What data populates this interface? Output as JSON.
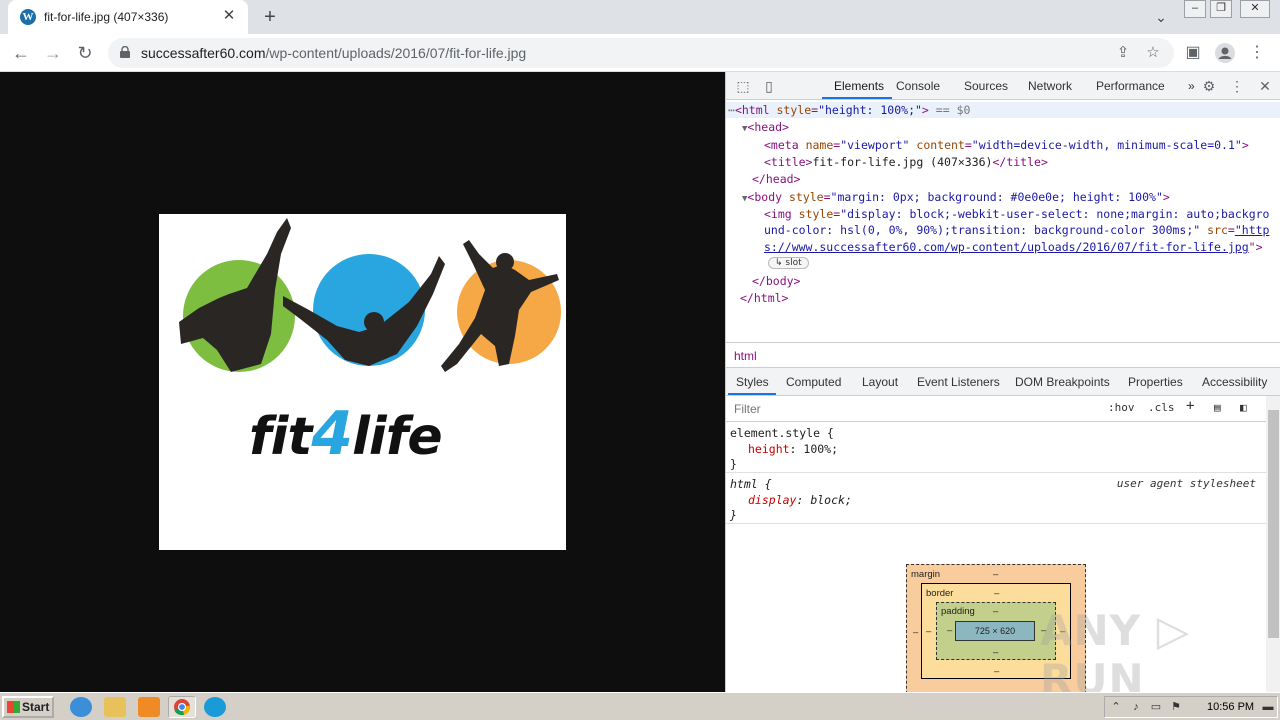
{
  "browser": {
    "tab_title": "fit-for-life.jpg (407×336)",
    "tab_close": "✕",
    "new_tab": "+",
    "url_host": "successafter60.com",
    "url_path": "/wp-content/uploads/2016/07/fit-for-life.jpg"
  },
  "image": {
    "logo_left": "fit",
    "logo_four": "4",
    "logo_right": "life"
  },
  "devtools": {
    "tabs": [
      "Elements",
      "Console",
      "Sources",
      "Network",
      "Performance"
    ],
    "more": "»",
    "dom": {
      "html_open": "<html",
      "html_attr_name": "style",
      "html_attr_val": "\"height: 100%;\"",
      "html_suffix": "== $0",
      "head_open": "<head>",
      "meta_name_attr": "name",
      "meta_name_val": "\"viewport\"",
      "meta_content_attr": "content",
      "meta_content_val": "\"width=device-width, minimum-scale=0.1\"",
      "title_open": "<title>",
      "title_text": "fit-for-life.jpg (407×336)",
      "title_close": "</title>",
      "head_close": "</head>",
      "body_open": "<body",
      "body_style_attr": "style",
      "body_style_val": "\"margin: 0px; background: #0e0e0e; height: 100%\"",
      "img_style_attr": "style",
      "img_style_val1": "\"display: block;-webkit-user-select: none;margin: auto;backgro",
      "img_style_val2": "und-color: hsl(0, 0%, 90%);transition: background-color 300ms;\"",
      "img_src_attr": "src",
      "img_src_val1": "\"http",
      "img_src_val2": "s://www.successafter60.com/wp-content/uploads/2016/07/fit-for-life.jpg",
      "img_src_close": "\">",
      "slot_badge": "slot",
      "body_close": "</body>",
      "html_close": "</html>"
    },
    "breadcrumb": "html",
    "panel_tabs": [
      "Styles",
      "Computed",
      "Layout",
      "Event Listeners",
      "DOM Breakpoints",
      "Properties",
      "Accessibility"
    ],
    "filter_placeholder": "Filter",
    "hov": ":hov",
    "cls": ".cls",
    "styles": {
      "rule1_selector": "element.style {",
      "rule1_prop": "height",
      "rule1_val": "100%;",
      "rule1_close": "}",
      "rule2_selector": "html {",
      "rule2_source": "user agent stylesheet",
      "rule2_prop": "display",
      "rule2_val": "block;",
      "rule2_close": "}"
    },
    "box_model": {
      "margin_label": "margin",
      "border_label": "border",
      "padding_label": "padding",
      "dash": "–",
      "content_size": "725 × 620"
    }
  },
  "watermark": "ANY ▷ RUN",
  "taskbar": {
    "start": "Start",
    "clock": "10:56 PM"
  },
  "colors": {
    "accent": "#1a73e8",
    "page_bg": "#0e0e0e",
    "logo_green": "#7dbd3f",
    "logo_blue": "#29a6e0",
    "logo_orange": "#f5a845"
  }
}
